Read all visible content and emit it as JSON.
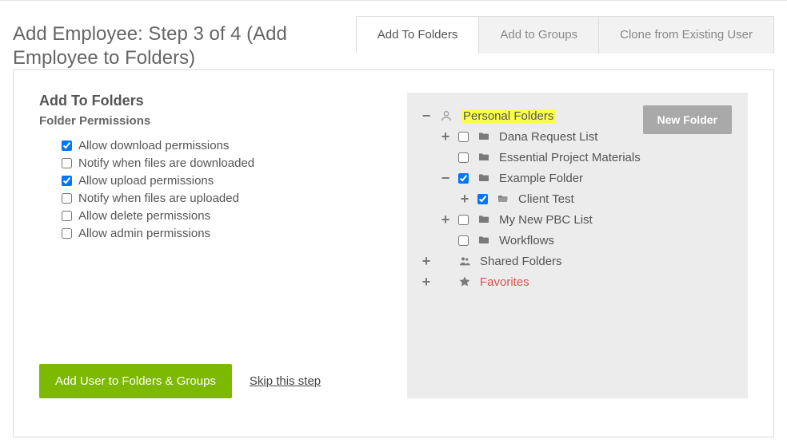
{
  "title": "Add Employee: Step 3 of 4 (Add Employee to Folders)",
  "tabs": [
    {
      "label": "Add To Folders",
      "active": true
    },
    {
      "label": "Add to Groups",
      "active": false
    },
    {
      "label": "Clone from Existing User",
      "active": false
    }
  ],
  "left": {
    "heading": "Add To Folders",
    "subheading": "Folder Permissions",
    "permissions": [
      {
        "label": "Allow download permissions",
        "checked": true
      },
      {
        "label": "Notify when files are downloaded",
        "checked": false
      },
      {
        "label": "Allow upload permissions",
        "checked": true
      },
      {
        "label": "Notify when files are uploaded",
        "checked": false
      },
      {
        "label": "Allow delete permissions",
        "checked": false
      },
      {
        "label": "Allow admin permissions",
        "checked": false
      }
    ],
    "primary_button": "Add User to Folders & Groups",
    "skip_link": "Skip this step"
  },
  "right": {
    "new_folder_button": "New Folder",
    "tree": {
      "personal": {
        "label": "Personal Folders",
        "children": [
          {
            "label": "Dana Request List",
            "expander": "+",
            "checked": false
          },
          {
            "label": "Essential Project Materials",
            "expander": "",
            "checked": false
          },
          {
            "label": "Example Folder",
            "expander": "−",
            "checked": true,
            "children": [
              {
                "label": "Client Test",
                "expander": "+",
                "checked": true,
                "open": true
              }
            ]
          },
          {
            "label": "My New PBC List",
            "expander": "+",
            "checked": false
          },
          {
            "label": "Workflows",
            "expander": "",
            "checked": false
          }
        ]
      },
      "shared": {
        "label": "Shared Folders",
        "expander": "+"
      },
      "favorites": {
        "label": "Favorites",
        "expander": "+"
      }
    }
  }
}
